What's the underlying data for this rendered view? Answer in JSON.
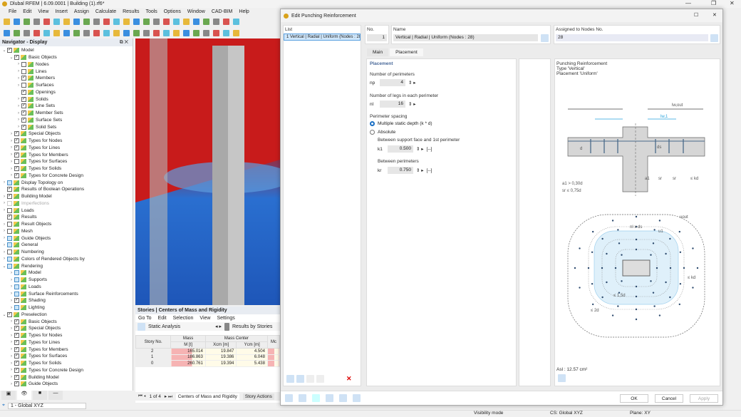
{
  "app": {
    "title": "Dlubal RFEM | 6.09.0001 | Building (1).rf6*"
  },
  "menu": [
    "File",
    "Edit",
    "View",
    "Insert",
    "Assign",
    "Calculate",
    "Results",
    "Tools",
    "Options",
    "Window",
    "CAD-BIM",
    "Help"
  ],
  "navigator": {
    "title": "Navigator - Display",
    "items": [
      {
        "label": "Model",
        "level": 0,
        "check": "on",
        "exp": "open"
      },
      {
        "label": "Basic Objects",
        "level": 1,
        "check": "on",
        "exp": "open"
      },
      {
        "label": "Nodes",
        "level": 2,
        "check": "off",
        "exp": "closed"
      },
      {
        "label": "Lines",
        "level": 2,
        "check": "off",
        "exp": "closed"
      },
      {
        "label": "Members",
        "level": 2,
        "check": "on",
        "exp": "closed"
      },
      {
        "label": "Surfaces",
        "level": 2,
        "check": "off",
        "exp": "closed"
      },
      {
        "label": "Openings",
        "level": 2,
        "check": "on",
        "exp": ""
      },
      {
        "label": "Solids",
        "level": 2,
        "check": "on",
        "exp": "closed"
      },
      {
        "label": "Line Sets",
        "level": 2,
        "check": "on",
        "exp": "closed"
      },
      {
        "label": "Member Sets",
        "level": 2,
        "check": "on",
        "exp": "closed"
      },
      {
        "label": "Surface Sets",
        "level": 2,
        "check": "on",
        "exp": "closed"
      },
      {
        "label": "Solid Sets",
        "level": 2,
        "check": "on",
        "exp": "closed"
      },
      {
        "label": "Special Objects",
        "level": 1,
        "check": "on",
        "exp": "closed"
      },
      {
        "label": "Types for Nodes",
        "level": 1,
        "check": "on",
        "exp": "closed"
      },
      {
        "label": "Types for Lines",
        "level": 1,
        "check": "on",
        "exp": "closed"
      },
      {
        "label": "Types for Members",
        "level": 1,
        "check": "on",
        "exp": "closed"
      },
      {
        "label": "Types for Surfaces",
        "level": 1,
        "check": "off",
        "exp": "closed"
      },
      {
        "label": "Types for Solids",
        "level": 1,
        "check": "on",
        "exp": "closed"
      },
      {
        "label": "Types for Concrete Design",
        "level": 1,
        "check": "on",
        "exp": "closed"
      },
      {
        "label": "Display Topology on",
        "level": 0,
        "check": "part",
        "exp": "closed"
      },
      {
        "label": "Results of Boolean Operations",
        "level": 0,
        "check": "on",
        "exp": ""
      },
      {
        "label": "Building Model",
        "level": 0,
        "check": "on",
        "exp": "closed"
      },
      {
        "label": "Imperfections",
        "level": 0,
        "check": "dim",
        "exp": "closed"
      },
      {
        "label": "Loads",
        "level": 0,
        "check": "off",
        "exp": "closed"
      },
      {
        "label": "Results",
        "level": 0,
        "check": "on",
        "exp": ""
      },
      {
        "label": "Result Objects",
        "level": 0,
        "check": "off",
        "exp": "closed"
      },
      {
        "label": "Mesh",
        "level": 0,
        "check": "off",
        "exp": "closed"
      },
      {
        "label": "Guide Objects",
        "level": 0,
        "check": "part",
        "exp": "closed"
      },
      {
        "label": "General",
        "level": 0,
        "check": "part",
        "exp": "closed"
      },
      {
        "label": "Numbering",
        "level": 0,
        "check": "off",
        "exp": "closed"
      },
      {
        "label": "Colors of Rendered Objects by",
        "level": 0,
        "check": "part",
        "exp": "closed"
      },
      {
        "label": "Rendering",
        "level": 0,
        "check": "part",
        "exp": "open"
      },
      {
        "label": "Model",
        "level": 1,
        "check": "part",
        "exp": "closed"
      },
      {
        "label": "Supports",
        "level": 1,
        "check": "part",
        "exp": "closed"
      },
      {
        "label": "Loads",
        "level": 1,
        "check": "part",
        "exp": "closed"
      },
      {
        "label": "Surface Reinforcements",
        "level": 1,
        "check": "part",
        "exp": "closed"
      },
      {
        "label": "Shading",
        "level": 1,
        "check": "on",
        "exp": "closed"
      },
      {
        "label": "Lighting",
        "level": 1,
        "check": "part",
        "exp": "closed"
      },
      {
        "label": "Preselection",
        "level": 0,
        "check": "on",
        "exp": "open"
      },
      {
        "label": "Basic Objects",
        "level": 1,
        "check": "on",
        "exp": "closed"
      },
      {
        "label": "Special Objects",
        "level": 1,
        "check": "on",
        "exp": "closed"
      },
      {
        "label": "Types for Nodes",
        "level": 1,
        "check": "on",
        "exp": "closed"
      },
      {
        "label": "Types for Lines",
        "level": 1,
        "check": "on",
        "exp": "closed"
      },
      {
        "label": "Types for Members",
        "level": 1,
        "check": "on",
        "exp": "closed"
      },
      {
        "label": "Types for Surfaces",
        "level": 1,
        "check": "on",
        "exp": "closed"
      },
      {
        "label": "Types for Solids",
        "level": 1,
        "check": "on",
        "exp": "closed"
      },
      {
        "label": "Types for Concrete Design",
        "level": 1,
        "check": "on",
        "exp": "closed"
      },
      {
        "label": "Building Model",
        "level": 1,
        "check": "on",
        "exp": "closed"
      },
      {
        "label": "Guide Objects",
        "level": 1,
        "check": "on",
        "exp": "closed"
      }
    ]
  },
  "coord_system": "1 - Global XYZ",
  "table": {
    "title": "Stories | Centers of Mass and Rigidity",
    "menu": [
      "Go To",
      "Edit",
      "Selection",
      "View",
      "Settings"
    ],
    "analysis": "Static Analysis",
    "results_by": "Results by Stories",
    "group_mass": "Mass",
    "group_center": "Mass Center",
    "col_story": "Story No.",
    "col_mass": "M [t]",
    "col_x": "Xcm [m]",
    "col_y": "Ycm [m]",
    "col_more": "Mc",
    "rows": [
      {
        "story": "2",
        "mass": "165.014",
        "x": "19.847",
        "y": "4.504"
      },
      {
        "story": "1",
        "mass": "186.863",
        "x": "19.386",
        "y": "6.048"
      },
      {
        "story": "0",
        "mass": "260.761",
        "x": "19.394",
        "y": "5.438"
      }
    ],
    "pager": "1 of 4",
    "tab1": "Centers of Mass and Rigidity",
    "tab2": "Story Actions"
  },
  "status": {
    "visibility": "Visibility mode",
    "cs": "CS: Global XYZ",
    "plane": "Plane: XY"
  },
  "dialog": {
    "title": "Edit Punching Reinforcement",
    "list_label": "List",
    "list_item": "1  Vertical | Radial | Uniform (Nodes : 28)",
    "no_label": "No.",
    "no_value": "1",
    "name_label": "Name",
    "name_value": "Vertical | Radial | Uniform (Nodes : 28)",
    "assigned_label": "Assigned to Nodes No.",
    "assigned_value": "28",
    "tabs": [
      "Main",
      "Placement"
    ],
    "placement": {
      "section": "Placement",
      "perimeters_label": "Number of perimeters",
      "np_sym": "np",
      "np_value": "4",
      "legs_label": "Number of legs in each perimeter",
      "nl_sym": "nl",
      "nl_value": "16",
      "spacing_label": "Perimeter spacing",
      "opt1": "Multiple static depth (k * d)",
      "opt2": "Absolute",
      "selected": "opt1",
      "k1_label": "Between support face and 1st perimeter",
      "k1_sym": "k1",
      "k1_value": "0.500",
      "k1_unit": "[--]",
      "kr_label": "Between perimeters",
      "kr_sym": "kr",
      "kr_value": "0.750",
      "kr_unit": "[--]"
    },
    "figure": {
      "line1": "Punching Reinforcement",
      "line2": "Type 'Vertical'",
      "line3": "Placement 'Uniform'",
      "lw_out": "lw,out",
      "lw1": "lw,1",
      "d": "d",
      "ds": "ds",
      "a1": "a1",
      "sr": "sr",
      "kd": "≤ kd",
      "cond1": "a1 > 0,30d",
      "cond2": "sr ≤ 0,75d",
      "uout": "uout",
      "u1": "u1",
      "nl_ds": "nl x ds",
      "kd2": "≤ kd",
      "d15": "≤ 1,5d",
      "d2": "≤ 2d"
    },
    "area": "Asl : 12.57 cm²",
    "ok": "OK",
    "cancel": "Cancel",
    "apply": "Apply"
  }
}
